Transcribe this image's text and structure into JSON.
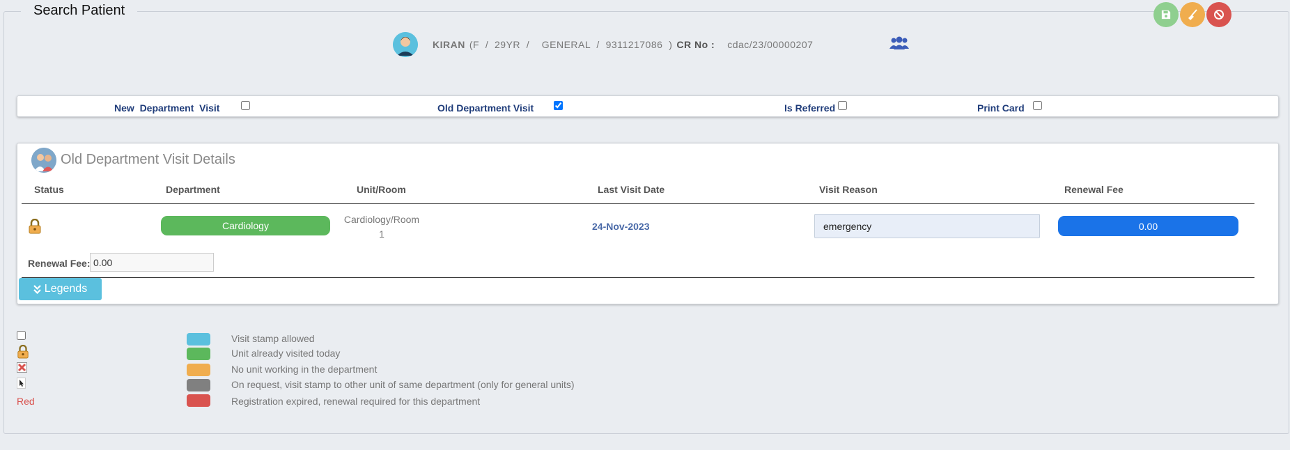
{
  "page": {
    "title": "Search Patient"
  },
  "patient": {
    "name": "KIRAN",
    "meta": "(F  /  29YR  /    GENERAL  /  9311217086  )",
    "cr_label": "CR No :",
    "cr_no": "cdac/23/00000207"
  },
  "options": {
    "new_visit": {
      "label": "New  Department  Visit",
      "checked": false
    },
    "old_visit": {
      "label": "Old Department Visit",
      "checked": true
    },
    "referred": {
      "label": "Is Referred",
      "checked": false
    },
    "print_card": {
      "label": "Print Card",
      "checked": false
    }
  },
  "visit_panel": {
    "title": "Old Department Visit Details",
    "headers": {
      "status": "Status",
      "department": "Department",
      "unit": "Unit/Room",
      "last_visit": "Last Visit Date",
      "reason": "Visit Reason",
      "fee": "Renewal Fee"
    },
    "row": {
      "status_icon": "lock-icon",
      "department": "Cardiology",
      "unit_line1": "Cardiology/Room",
      "unit_line2": "1",
      "last_visit": "24-Nov-2023",
      "reason": "emergency",
      "fee": "0.00"
    },
    "renewal_label": "Renewal Fee:",
    "renewal_value": "0.00",
    "legends_button": "Legends"
  },
  "legends": [
    {
      "symbol": "checkbox",
      "color": "#5bc0de",
      "text": "Visit stamp allowed"
    },
    {
      "symbol": "lock-icon",
      "color": "#5cb85c",
      "text": "Unit already visited today"
    },
    {
      "symbol": "cross-icon",
      "color": "#f0ad4e",
      "text": "No unit working in the department"
    },
    {
      "symbol": "cursor-icon",
      "color": "#808080",
      "text": "On request, visit stamp to other unit of same department (only for general units)"
    },
    {
      "symbol": "Red",
      "color": "#d9534f",
      "text": "Registration expired, renewal required for this department"
    }
  ],
  "colors": {
    "save": "#8fcf8f",
    "clear": "#f0ad4e",
    "cancel": "#d9534f",
    "department_badge": "#5cb85c",
    "fee_pill": "#1a73e8"
  }
}
